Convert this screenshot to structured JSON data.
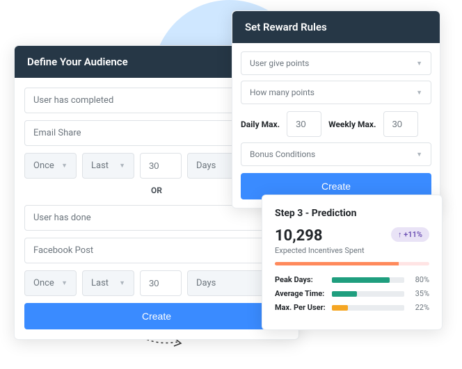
{
  "audience": {
    "title": "Define Your Audience",
    "group1": {
      "trigger": "User has completed",
      "channel": "Email Share",
      "freq": "Once",
      "period": "Last",
      "count": "30",
      "unit": "Days"
    },
    "divider": "OR",
    "group2": {
      "trigger": "User has done",
      "channel": "Facebook Post",
      "freq": "Once",
      "period": "Last",
      "count": "30",
      "unit": "Days"
    },
    "create": "Create"
  },
  "reward": {
    "title": "Set Reward Rules",
    "type": "User give points",
    "amount": "How many points",
    "daily_label": "Daily Max.",
    "daily_value": "30",
    "weekly_label": "Weekly Max.",
    "weekly_value": "30",
    "bonus": "Bonus Conditions",
    "create": "Create"
  },
  "prediction": {
    "title": "Step 3 - Prediction",
    "value": "10,298",
    "badge": "↑ +11%",
    "subtitle": "Expected Incentives Spent",
    "stats": [
      {
        "label": "Peak Days:",
        "pct": 80,
        "color": "#1f9e7e",
        "txt": "80%"
      },
      {
        "label": "Average Time:",
        "pct": 35,
        "color": "#1f9e7e",
        "txt": "35%"
      },
      {
        "label": "Max. Per User:",
        "pct": 22,
        "color": "#f5a623",
        "txt": "22%"
      }
    ]
  }
}
